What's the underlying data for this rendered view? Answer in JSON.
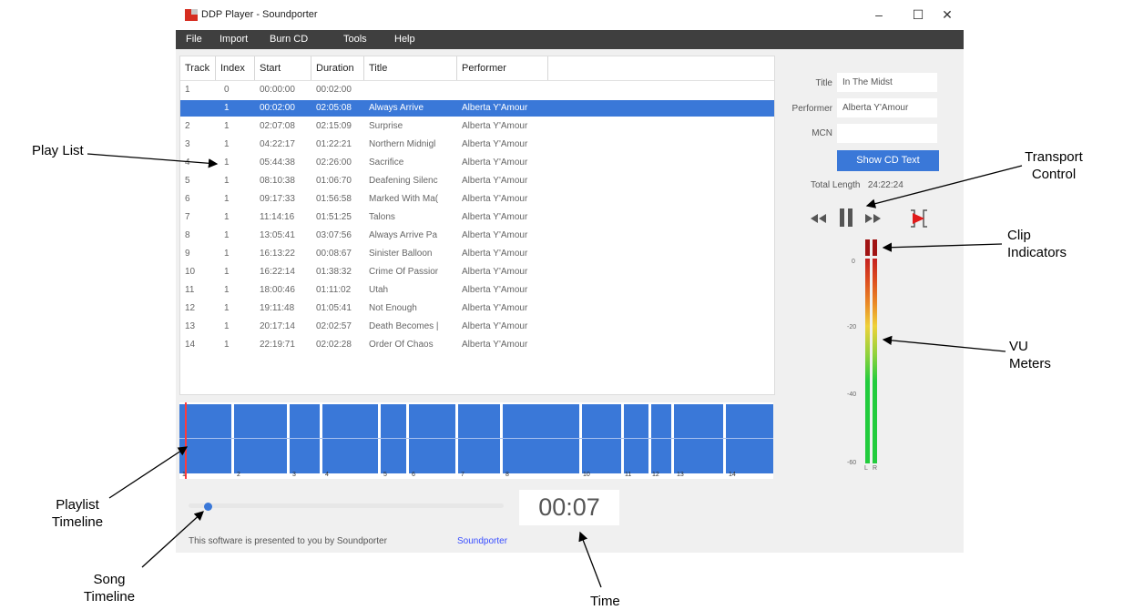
{
  "window": {
    "title": "DDP Player - Soundporter",
    "controls": {
      "minimize": "–",
      "maximize": "☐",
      "close": "✕"
    }
  },
  "menu": [
    "File",
    "Import",
    "Burn CD",
    "Tools",
    "Help"
  ],
  "playlist": {
    "columns": [
      "Track",
      "Index",
      "Start",
      "Duration",
      "Title",
      "Performer"
    ],
    "rows": [
      {
        "track": "1",
        "index": "0",
        "start": "00:00:00",
        "duration": "00:02:00",
        "title": "",
        "performer": ""
      },
      {
        "track": "",
        "index": "1",
        "start": "00:02:00",
        "duration": "02:05:08",
        "title": "Always Arrive",
        "performer": "Alberta Y'Amour",
        "selected": true
      },
      {
        "track": "2",
        "index": "1",
        "start": "02:07:08",
        "duration": "02:15:09",
        "title": "Surprise",
        "performer": "Alberta Y'Amour"
      },
      {
        "track": "3",
        "index": "1",
        "start": "04:22:17",
        "duration": "01:22:21",
        "title": "Northern Midnigl",
        "performer": "Alberta Y'Amour"
      },
      {
        "track": "4",
        "index": "1",
        "start": "05:44:38",
        "duration": "02:26:00",
        "title": "Sacrifice",
        "performer": "Alberta Y'Amour"
      },
      {
        "track": "5",
        "index": "1",
        "start": "08:10:38",
        "duration": "01:06:70",
        "title": "Deafening Silenc",
        "performer": "Alberta Y'Amour"
      },
      {
        "track": "6",
        "index": "1",
        "start": "09:17:33",
        "duration": "01:56:58",
        "title": "Marked With Ma(",
        "performer": "Alberta Y'Amour"
      },
      {
        "track": "7",
        "index": "1",
        "start": "11:14:16",
        "duration": "01:51:25",
        "title": "Talons",
        "performer": "Alberta Y'Amour"
      },
      {
        "track": "8",
        "index": "1",
        "start": "13:05:41",
        "duration": "03:07:56",
        "title": "Always Arrive Pa",
        "performer": "Alberta Y'Amour"
      },
      {
        "track": "9",
        "index": "1",
        "start": "16:13:22",
        "duration": "00:08:67",
        "title": "Sinister Balloon",
        "performer": "Alberta Y'Amour"
      },
      {
        "track": "10",
        "index": "1",
        "start": "16:22:14",
        "duration": "01:38:32",
        "title": "Crime Of Passior",
        "performer": "Alberta Y'Amour"
      },
      {
        "track": "11",
        "index": "1",
        "start": "18:00:46",
        "duration": "01:11:02",
        "title": "Utah",
        "performer": "Alberta Y'Amour"
      },
      {
        "track": "12",
        "index": "1",
        "start": "19:11:48",
        "duration": "01:05:41",
        "title": "Not Enough",
        "performer": "Alberta Y'Amour"
      },
      {
        "track": "13",
        "index": "1",
        "start": "20:17:14",
        "duration": "02:02:57",
        "title": "Death Becomes |",
        "performer": "Alberta Y'Amour"
      },
      {
        "track": "14",
        "index": "1",
        "start": "22:19:71",
        "duration": "02:02:28",
        "title": "Order Of Chaos",
        "performer": "Alberta Y'Amour"
      }
    ]
  },
  "timeline": {
    "markers": [
      "1",
      "2",
      "3",
      "4",
      "5",
      "6",
      "7",
      "8",
      "10",
      "11",
      "12",
      "13",
      "14"
    ]
  },
  "song_timeline": {
    "position_fraction": 0.06
  },
  "time_display": "00:07",
  "cd_info": {
    "title_label": "Title",
    "title_value": "In The Midst",
    "performer_label": "Performer",
    "performer_value": "Alberta Y'Amour",
    "mcn_label": "MCN",
    "mcn_value": "",
    "show_cd_text": "Show CD Text",
    "total_length_label": "Total Length",
    "total_length_value": "24:22:24"
  },
  "transport": {
    "icons": [
      "rewind-icon",
      "pause-icon",
      "fast-forward-icon",
      "play-selection-icon"
    ]
  },
  "vu": {
    "scale": [
      "0",
      "-20",
      "-40",
      "-60"
    ],
    "left_label": "L",
    "right_label": "R"
  },
  "footer": {
    "text": "This software is presented to you by Soundporter",
    "link": "Soundporter"
  },
  "annotations": {
    "play_list": "Play List",
    "transport_control": "Transport\nControl",
    "clip_indicators": "Clip\nIndicators",
    "vu_meters": "VU\nMeters",
    "playlist_timeline": "Playlist\nTimeline",
    "song_timeline": "Song\nTimeline",
    "time": "Time"
  },
  "colors": {
    "accent": "#3a78d8",
    "menubar": "#3f3f3f",
    "clip": "#a11414",
    "link": "#3a4fff"
  }
}
